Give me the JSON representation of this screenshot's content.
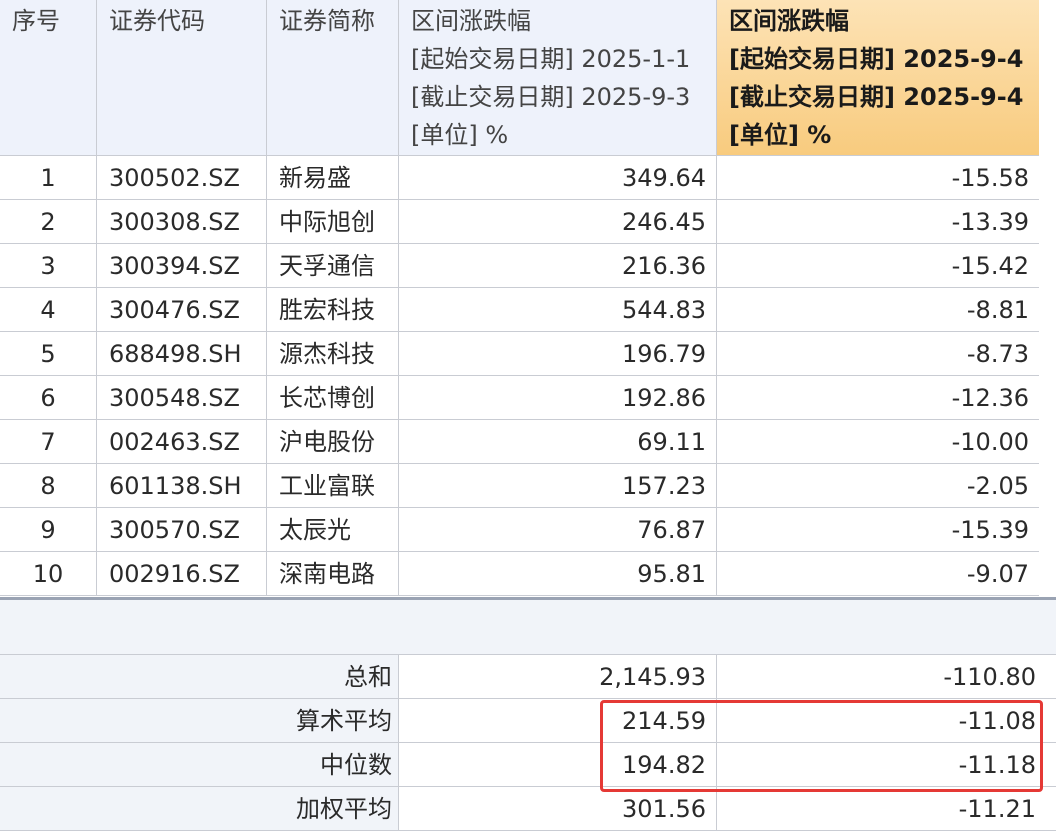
{
  "table": {
    "headers": {
      "seq": "序号",
      "code": "证券代码",
      "name": "证券简称",
      "col1": {
        "title": "区间涨跌幅",
        "start": "[起始交易日期] 2025-1-1",
        "end": "[截止交易日期] 2025-9-3",
        "unit": "[单位] %"
      },
      "col2": {
        "title": "区间涨跌幅",
        "start": "[起始交易日期] 2025-9-4",
        "end": "[截止交易日期] 2025-9-4",
        "unit": "[单位] %"
      }
    },
    "rows": [
      {
        "seq": "1",
        "code": "300502.SZ",
        "name": "新易盛",
        "v1": "349.64",
        "v2": "-15.58"
      },
      {
        "seq": "2",
        "code": "300308.SZ",
        "name": "中际旭创",
        "v1": "246.45",
        "v2": "-13.39"
      },
      {
        "seq": "3",
        "code": "300394.SZ",
        "name": "天孚通信",
        "v1": "216.36",
        "v2": "-15.42"
      },
      {
        "seq": "4",
        "code": "300476.SZ",
        "name": "胜宏科技",
        "v1": "544.83",
        "v2": "-8.81"
      },
      {
        "seq": "5",
        "code": "688498.SH",
        "name": "源杰科技",
        "v1": "196.79",
        "v2": "-8.73"
      },
      {
        "seq": "6",
        "code": "300548.SZ",
        "name": "长芯博创",
        "v1": "192.86",
        "v2": "-12.36"
      },
      {
        "seq": "7",
        "code": "002463.SZ",
        "name": "沪电股份",
        "v1": "69.11",
        "v2": "-10.00"
      },
      {
        "seq": "8",
        "code": "601138.SH",
        "name": "工业富联",
        "v1": "157.23",
        "v2": "-2.05"
      },
      {
        "seq": "9",
        "code": "300570.SZ",
        "name": "太辰光",
        "v1": "76.87",
        "v2": "-15.39"
      },
      {
        "seq": "10",
        "code": "002916.SZ",
        "name": "深南电路",
        "v1": "95.81",
        "v2": "-9.07"
      }
    ],
    "stats": [
      {
        "label": "总和",
        "v1": "2,145.93",
        "v2": "-110.80"
      },
      {
        "label": "算术平均",
        "v1": "214.59",
        "v2": "-11.08"
      },
      {
        "label": "中位数",
        "v1": "194.82",
        "v2": "-11.18"
      },
      {
        "label": "加权平均",
        "v1": "301.56",
        "v2": "-11.21"
      }
    ]
  },
  "colors": {
    "header_bg": "#eef2fb",
    "highlight_header": "#f8cb7e",
    "highlight_box": "#e53935"
  }
}
